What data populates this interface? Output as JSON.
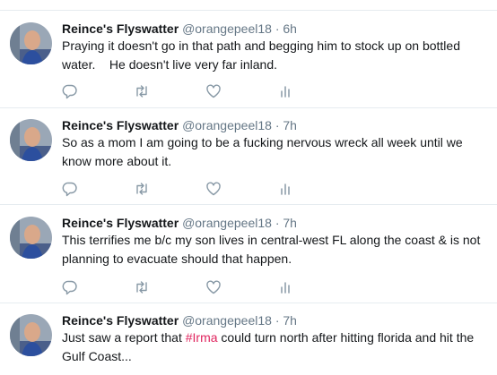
{
  "colors": {
    "text": "#14171a",
    "secondary": "#657786",
    "icon": "#8899a6",
    "divider": "#e6ecf0",
    "hashtag": "#e0245e"
  },
  "tweets": [
    {
      "name": "Reince's Flyswatter",
      "handle": "@orangepeel18",
      "separator": "·",
      "time": "6h",
      "text": "Praying it doesn't go in that path and begging him to stock up on bottled water.    He doesn't live very far inland.",
      "icons": [
        "reply-icon",
        "retweet-icon",
        "like-icon",
        "analytics-icon"
      ]
    },
    {
      "name": "Reince's Flyswatter",
      "handle": "@orangepeel18",
      "separator": "·",
      "time": "7h",
      "text": "So as a mom I am going to be a fucking nervous wreck all week until we know more about it.",
      "icons": [
        "reply-icon",
        "retweet-icon",
        "like-icon",
        "analytics-icon"
      ]
    },
    {
      "name": "Reince's Flyswatter",
      "handle": "@orangepeel18",
      "separator": "·",
      "time": "7h",
      "text": "This terrifies me b/c my son lives in central-west FL along the coast & is not planning to evacuate should that happen.",
      "icons": [
        "reply-icon",
        "retweet-icon",
        "like-icon",
        "analytics-icon"
      ]
    },
    {
      "name": "Reince's Flyswatter",
      "handle": "@orangepeel18",
      "separator": "·",
      "time": "7h",
      "text_before": "Just saw a report that ",
      "hashtag": "#Irma",
      "text_after": " could turn north after hitting florida and hit the Gulf Coast..."
    }
  ]
}
